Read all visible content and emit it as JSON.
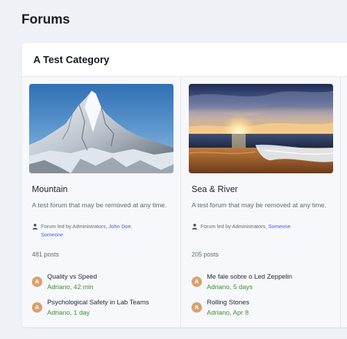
{
  "page": {
    "title": "Forums"
  },
  "category": {
    "title": "A Test Category"
  },
  "forums": [
    {
      "name": "Mountain",
      "description": "A test forum that may be removed at any time.",
      "led_prefix": "Forum led by Administrators, ",
      "led_user_1": "John Doe",
      "led_separator": ",",
      "led_user_2": "Someone",
      "posts": "481 posts",
      "threads": [
        {
          "avatar": "A",
          "title": "Quality vs Speed",
          "author": "Adriano",
          "sep": ", ",
          "time": "42 min"
        },
        {
          "avatar": "A",
          "title": "Psychological Safety in Lab Teams",
          "author": "Adriano",
          "sep": ", ",
          "time": "1 day"
        }
      ]
    },
    {
      "name": "Sea & River",
      "description": "A test forum that may be removed at any time.",
      "led_prefix": "Forum led by Administrators, ",
      "led_user_1": "Someone",
      "posts": "205 posts",
      "threads": [
        {
          "avatar": "A",
          "title": "Me fale sobre o Led Zeppelin",
          "author": "Adriano",
          "sep": ", ",
          "time": "5 days"
        },
        {
          "avatar": "A",
          "title": "Rolling Stones",
          "author": "Adriano",
          "sep": ", ",
          "time": "Apr 8"
        }
      ]
    }
  ],
  "colors": {
    "link": "#3b5bd6",
    "meta_green": "#3f8f2e",
    "avatar": "#d9a16b"
  }
}
